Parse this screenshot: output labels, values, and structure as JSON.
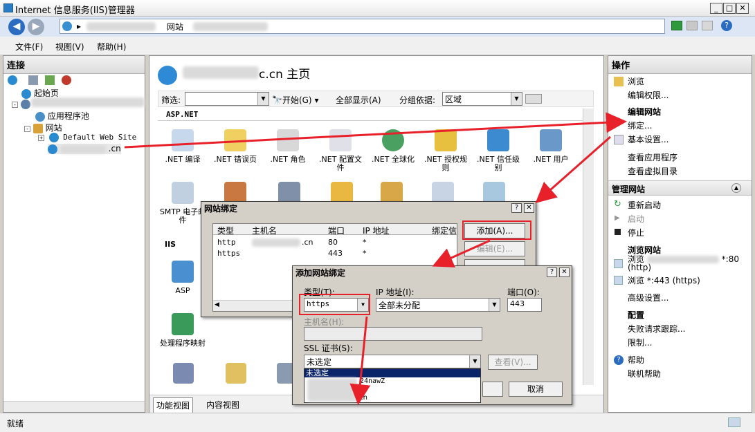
{
  "window": {
    "title": "Internet 信息服务(IIS)管理器"
  },
  "address": {
    "crumb_1": "网站",
    "sep": "▸"
  },
  "menu": {
    "file": "文件(F)",
    "view": "视图(V)",
    "help": "帮助(H)"
  },
  "connections": {
    "header": "连接",
    "start_page": "起始页",
    "app_pools": "应用程序池",
    "sites": "网站",
    "default_site": "Default Web Site",
    "site_suffix": ".cn"
  },
  "center": {
    "page_title": "c.cn 主页",
    "filter_label": "筛选:",
    "start_btn": "开始(G)",
    "show_all_btn": "全部显示(A)",
    "group_by_label": "分组依据:",
    "group_by_value": "区域",
    "section_aspnet": "ASP.NET",
    "section_iis": "IIS",
    "features": [
      ".NET 编译",
      ".NET 错误页",
      ".NET 角色",
      ".NET 配置文件",
      ".NET 全球化",
      ".NET 授权规则",
      ".NET 信任级别",
      ".NET 用户"
    ],
    "smtp_label": "SMTP 电子邮件",
    "asp_label": "ASP",
    "handler_label": "处理程序映射",
    "tab_features": "功能视图",
    "tab_content": "内容视图"
  },
  "actions": {
    "header": "操作",
    "browse": "浏览",
    "edit_perms": "编辑权限...",
    "edit_site": "编辑网站",
    "bindings": "绑定...",
    "basic_settings": "基本设置...",
    "view_apps": "查看应用程序",
    "view_vdirs": "查看虚拟目录",
    "manage_site": "管理网站",
    "restart": "重新启动",
    "start": "启动",
    "stop": "停止",
    "browse_site": "浏览网站",
    "browse_http_prefix": "浏览",
    "browse_http_suffix": "*:80",
    "browse_http_proto": "(http)",
    "browse_https": "浏览 *:443 (https)",
    "advanced": "高级设置...",
    "config": "配置",
    "failed_trace": "失败请求跟踪...",
    "limits": "限制...",
    "help": "帮助",
    "online_help": "联机帮助"
  },
  "bindings_dialog": {
    "title": "网站绑定",
    "columns": [
      "类型",
      "主机名",
      "端口",
      "IP 地址",
      "绑定信"
    ],
    "rows": [
      {
        "type": "http",
        "host_suffix": ".cn",
        "port": "80",
        "ip": "*"
      },
      {
        "type": "https",
        "host_suffix": "",
        "port": "443",
        "ip": "*"
      }
    ],
    "add_btn": "添加(A)...",
    "edit_btn": "编辑(E)..."
  },
  "add_dialog": {
    "title": "添加网站绑定",
    "type_label": "类型(T):",
    "type_value": "https",
    "ip_label": "IP 地址(I):",
    "ip_value": "全部未分配",
    "port_label": "端口(O):",
    "port_value": "443",
    "host_label": "主机名(H):",
    "ssl_label": "SSL 证书(S):",
    "ssl_value": "未选定",
    "view_btn": "查看(V)...",
    "cancel_btn": "取消",
    "dropdown_options": [
      "未选定",
      "24nawZ",
      ".cn",
      ".cn"
    ]
  },
  "status": {
    "text": "就绪"
  },
  "colors": {
    "accent": "#0a246a",
    "red": "#e8202a",
    "dialog_title": "#d4d0c8"
  }
}
